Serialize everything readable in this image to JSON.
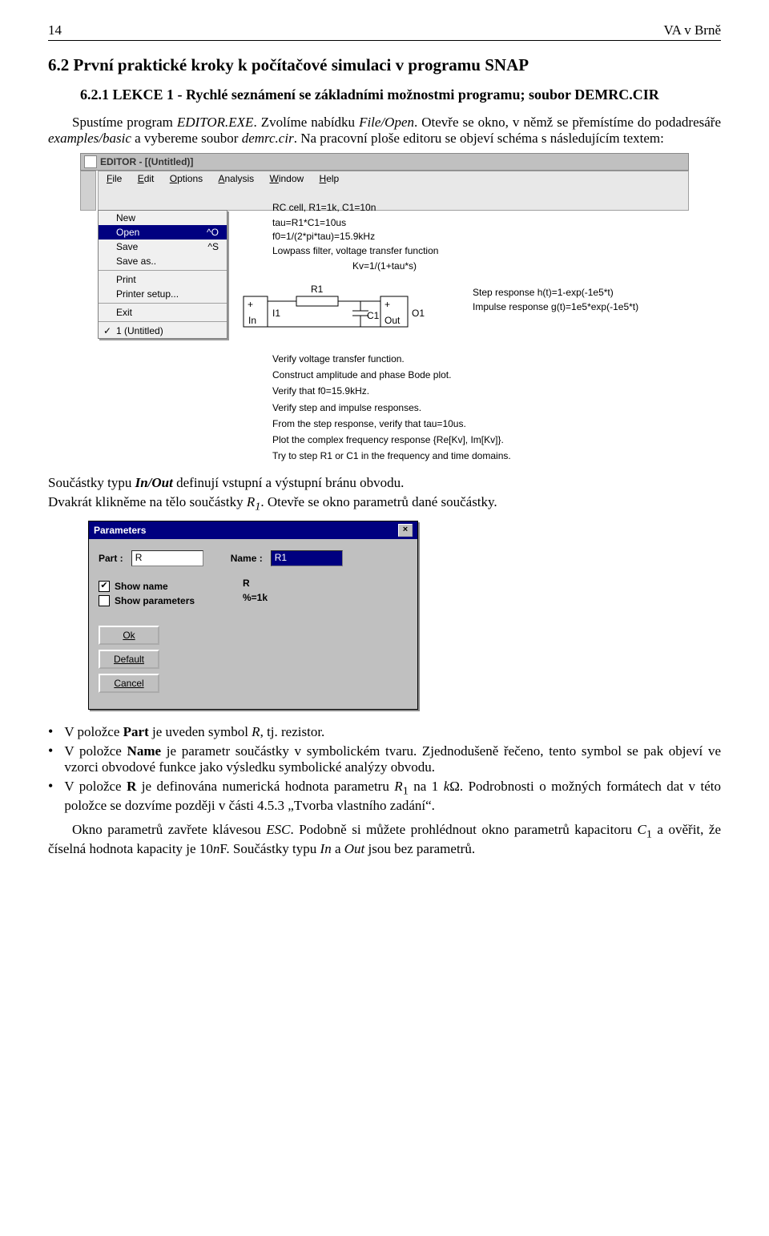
{
  "header": {
    "page_num": "14",
    "right": "VA v Brně"
  },
  "h2": "6.2  První praktické kroky k počítačové simulaci v programu SNAP",
  "h3": "6.2.1  LEKCE 1 - Rychlé seznámení se základními možnostmi programu; soubor DEMRC.CIR",
  "para1_plain1": "Spustíme program ",
  "para1_it1": "EDITOR.EXE",
  "para1_plain2": ". Zvolíme nabídku ",
  "para1_it2": "File/Open",
  "para1_plain3": ". Otevře se okno, v němž se přemístíme do podadresáře ",
  "para1_it3": "examples/basic",
  "para1_plain4": " a vybereme soubor ",
  "para1_it4": "demrc.cir",
  "para1_plain5": ". Na pracovní ploše editoru se objeví schéma s následujícím textem:",
  "editor": {
    "title": "EDITOR - [(Untitled)]",
    "menu": {
      "file": "File",
      "edit": "Edit",
      "options": "Options",
      "analysis": "Analysis",
      "window": "Window",
      "help": "Help"
    },
    "filemenu": {
      "new": "New",
      "open": "Open",
      "open_sc": "^O",
      "save": "Save",
      "save_sc": "^S",
      "saveas": "Save as..",
      "print": "Print",
      "psetup": "Printer setup...",
      "exit": "Exit",
      "recent": "1 (Untitled)"
    },
    "canvas": {
      "line1": "RC cell, R1=1k, C1=10n",
      "line2": "tau=R1*C1=10us",
      "line3": "f0=1/(2*pi*tau)=15.9kHz",
      "line4": "Lowpass filter, voltage transfer function",
      "line5": "Kv=1/(1+tau*s)",
      "step_lbl": "Step response h(t)=1-exp(-1e5*t)",
      "imp_lbl": "Impulse response g(t)=1e5*exp(-1e5*t)",
      "tasks": [
        "Verify voltage transfer function.",
        "Construct amplitude and phase Bode plot.",
        "Verify that f0=15.9kHz.",
        "Verify step and impulse responses.",
        "From the step response, verify that tau=10us.",
        "Plot the complex frequency response {Re[Kv], Im[Kv]}.",
        "Try to step R1 or C1 in the frequency and time domains."
      ],
      "comp": {
        "in": "In",
        "i1": "I1",
        "r1": "R1",
        "c1": "C1",
        "out": "Out",
        "o1": "O1"
      }
    }
  },
  "mid1a": "Součástky typu ",
  "mid1b": "In/Out",
  "mid1c": " definují vstupní a výstupní bránu obvodu.",
  "mid2a": "Dvakrát klikněme na tělo součástky ",
  "mid2b": "R",
  "mid2c": "1",
  "mid2d": ". Otevře se okno parametrů dané součástky.",
  "dlg": {
    "title": "Parameters",
    "part_lbl": "Part :",
    "part_val": "R",
    "name_lbl": "Name :",
    "name_val": "R1",
    "showname_lbl": "Show name",
    "showparams_lbl": "Show parameters",
    "plain_r": "R",
    "param_expr": "%=1k",
    "btn_ok": "Ok",
    "btn_def": "Default",
    "btn_cancel": "Cancel"
  },
  "bul1a": "V položce ",
  "bul1b": "Part",
  "bul1c": " je uveden symbol ",
  "bul1d": "R",
  "bul1e": ", tj. rezistor.",
  "bul2a": "V položce ",
  "bul2b": "Name",
  "bul2c": " je parametr součástky v symbolickém tvaru. Zjednodušeně řečeno, tento symbol se pak objeví ve vzorci obvodové funkce jako výsledku symbolické analýzy obvodu.",
  "bul3a": "V položce ",
  "bul3b": "R",
  "bul3c": " je definována numerická hodnota parametru ",
  "bul3d": "R",
  "bul3e": "1",
  "bul3f": " na 1 ",
  "bul3g": "k",
  "bul3h": "Ω. Podrobnosti o možných formátech dat v této položce se dozvíme později v části 4.5.3 „Tvorba vlastního zadání“.",
  "endpara_a": "Okno parametrů zavřete klávesou ",
  "endpara_b": "ESC",
  "endpara_c": ". Podobně si můžete prohlédnout okno parametrů kapacitoru ",
  "endpara_d": "C",
  "endpara_e": "1",
  "endpara_f": " a ověřit, že číselná hodnota kapacity je 10",
  "endpara_g": "n",
  "endpara_h": "F. Součástky typu ",
  "endpara_i": "In",
  "endpara_j": " a ",
  "endpara_k": "Out",
  "endpara_l": " jsou bez parametrů."
}
